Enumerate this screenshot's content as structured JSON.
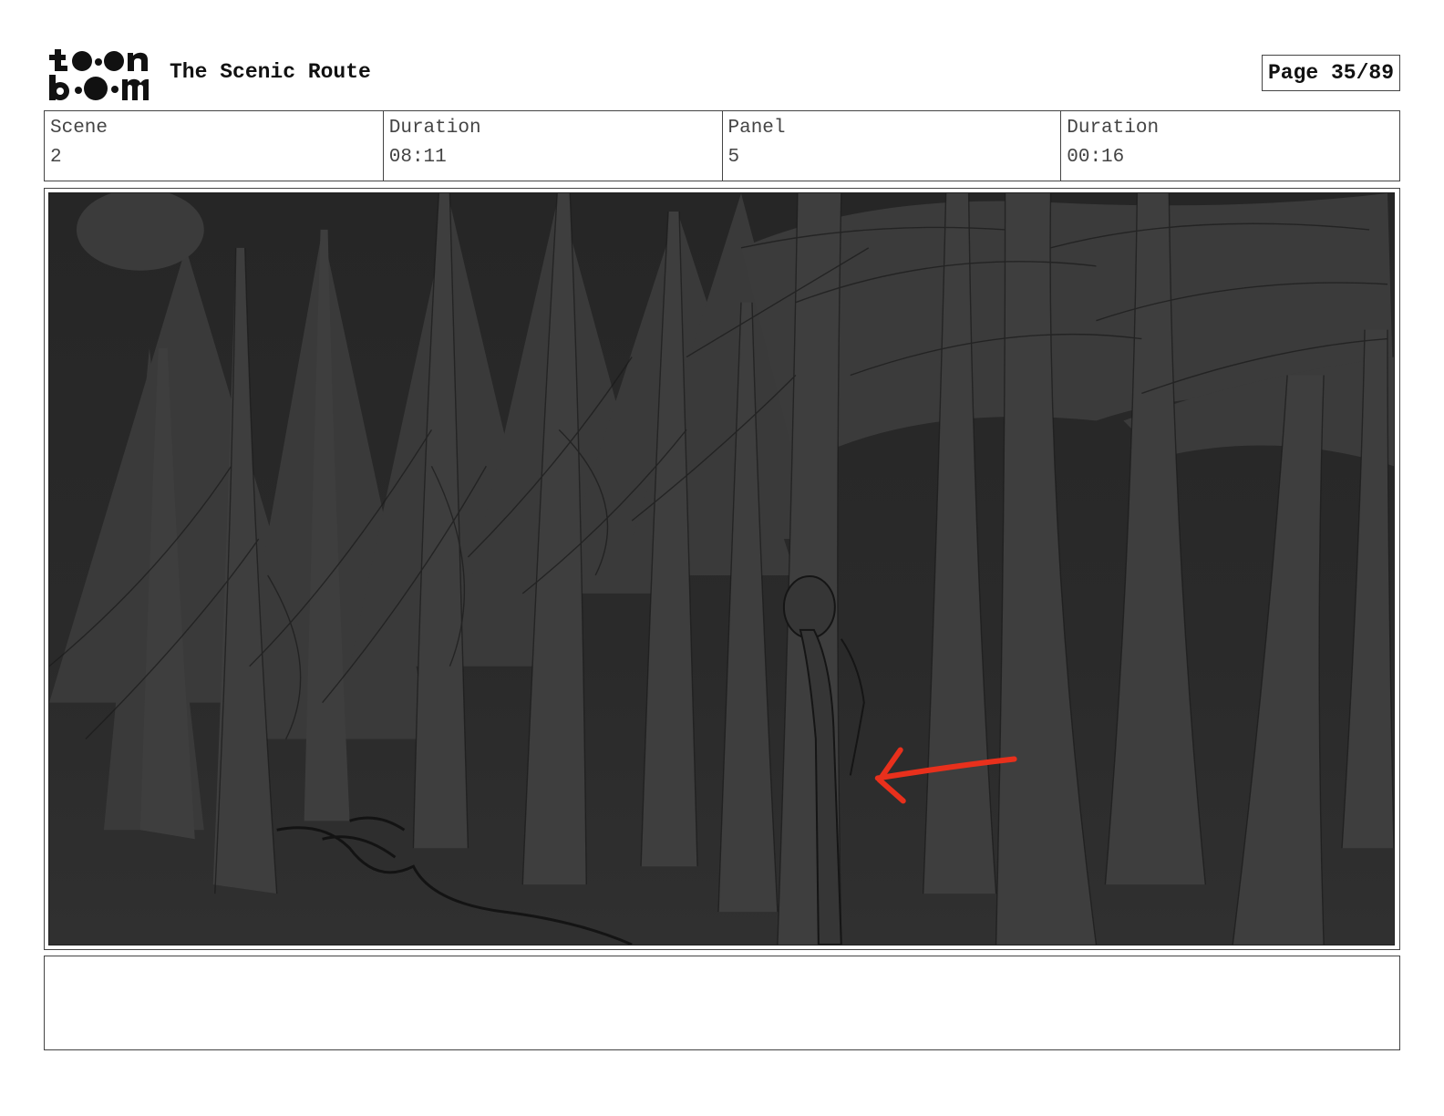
{
  "header": {
    "logo_text": "toon boom",
    "project_title": "The Scenic Route",
    "page_label": "Page 35/89"
  },
  "info": {
    "scene_label": "Scene",
    "scene_value": "2",
    "scene_duration_label": "Duration",
    "scene_duration_value": "08:11",
    "panel_label": "Panel",
    "panel_value": "5",
    "panel_duration_label": "Duration",
    "panel_duration_value": "00:16"
  },
  "panel": {
    "description": "",
    "arrow_color": "#e8301c"
  },
  "notes": {
    "text": ""
  }
}
